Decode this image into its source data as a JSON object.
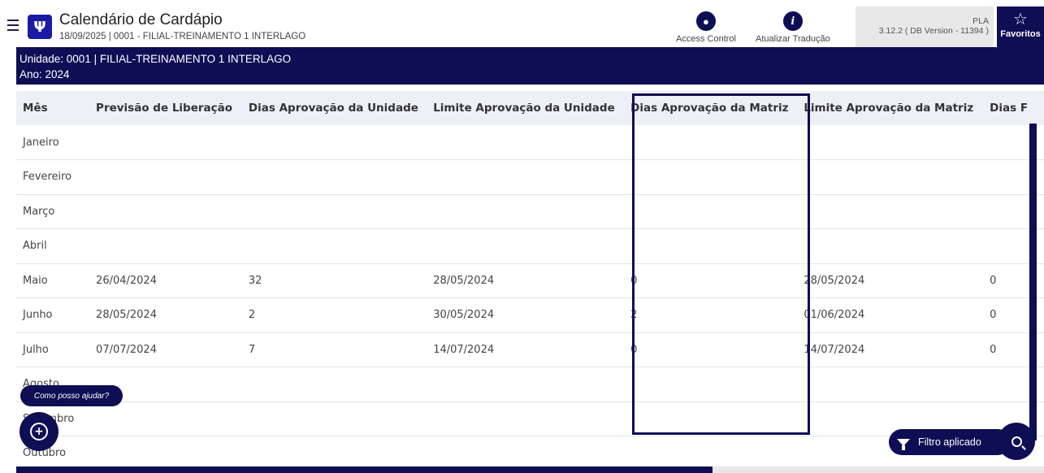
{
  "header": {
    "title": "Calendário de Cardápio",
    "subtitle": "18/09/2025 | 0001 - FILIAL-TREINAMENTO 1 INTERLAGO",
    "actions": [
      {
        "label": "Access Control",
        "icon": "lock-icon"
      },
      {
        "label": "Atualizar Tradução",
        "icon": "info-icon"
      }
    ],
    "version_top": "PLA",
    "version": "3.12.2 ( DB Version - 11394 )",
    "favorites_label": "Favoritos"
  },
  "unit_band": {
    "line1": "Unidade: 0001 | FILIAL-TREINAMENTO 1 INTERLAGO",
    "line2": "Ano: 2024"
  },
  "table": {
    "columns": [
      "Mês",
      "Previsão de Liberação",
      "Dias Aprovação da Unidade",
      "Limite Aprovação da Unidade",
      "Dias Aprovação da Matriz",
      "Limite Aprovação da Matriz",
      "Dias F"
    ],
    "rows": [
      [
        "Janeiro",
        "",
        "",
        "",
        "",
        "",
        ""
      ],
      [
        "Fevereiro",
        "",
        "",
        "",
        "",
        "",
        ""
      ],
      [
        "Março",
        "",
        "",
        "",
        "",
        "",
        ""
      ],
      [
        "Abril",
        "",
        "",
        "",
        "",
        "",
        ""
      ],
      [
        "Maio",
        "26/04/2024",
        "32",
        "28/05/2024",
        "0",
        "28/05/2024",
        "0"
      ],
      [
        "Junho",
        "28/05/2024",
        "2",
        "30/05/2024",
        "2",
        "01/06/2024",
        "0"
      ],
      [
        "Julho",
        "07/07/2024",
        "7",
        "14/07/2024",
        "0",
        "14/07/2024",
        "0"
      ],
      [
        "Agosto",
        "",
        "",
        "",
        "",
        "",
        ""
      ],
      [
        "Setembro",
        "",
        "",
        "",
        "",
        "",
        ""
      ],
      [
        "Outubro",
        "",
        "",
        "",
        "",
        "",
        ""
      ]
    ]
  },
  "help": {
    "bubble": "Como posso ajudar?"
  },
  "filter": {
    "label": "Filtro aplicado"
  },
  "colors": {
    "navy": "#0e0e55",
    "logo_blue": "#1a1aa3",
    "header_row": "#eef0f7"
  }
}
